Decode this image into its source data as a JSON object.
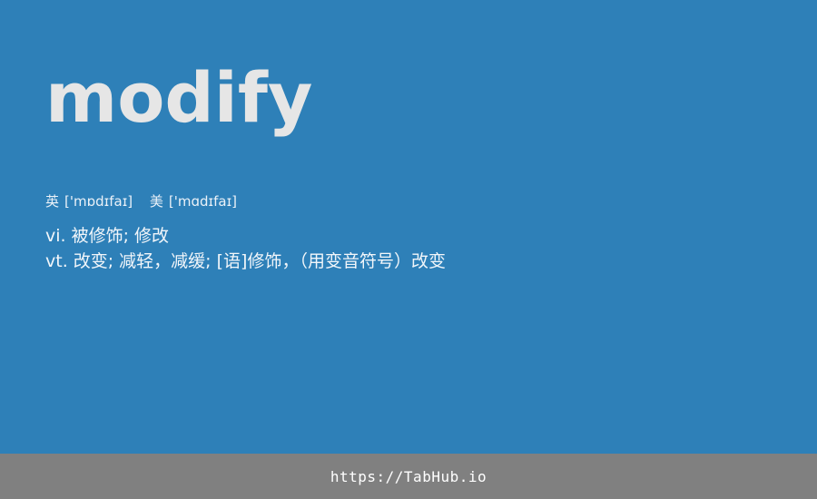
{
  "word": "modify",
  "phonetics": {
    "uk_label": "英",
    "uk_ipa": "['mɒdɪfaɪ]",
    "us_label": "美",
    "us_ipa": "['mɑdɪfaɪ]"
  },
  "definitions": [
    {
      "pos": "vi.",
      "meaning": "被修饰; 修改"
    },
    {
      "pos": "vt.",
      "meaning": "改变; 减轻，减缓; [语]修饰，（用变音符号）改变"
    }
  ],
  "footer": {
    "link_text": "https://TabHub.io"
  },
  "colors": {
    "background": "#2e80b8",
    "word_text": "#e6e6e6",
    "footer_background": "#808080",
    "footer_text": "#ffffff"
  }
}
